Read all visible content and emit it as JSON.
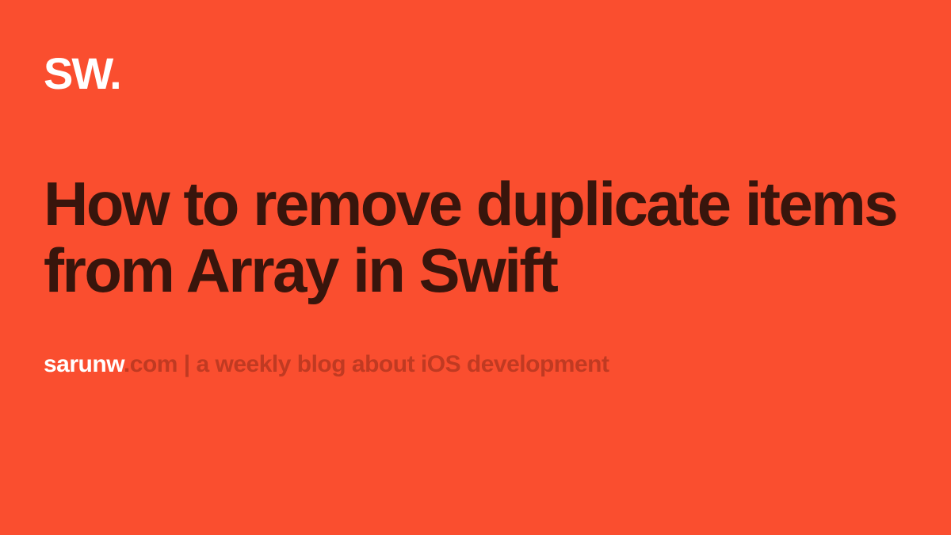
{
  "logo": "SW.",
  "title": "How to remove duplicate items from Array in Swift",
  "footer": {
    "domain": "sarunw",
    "tagline": ".com | a weekly blog about iOS development"
  }
}
